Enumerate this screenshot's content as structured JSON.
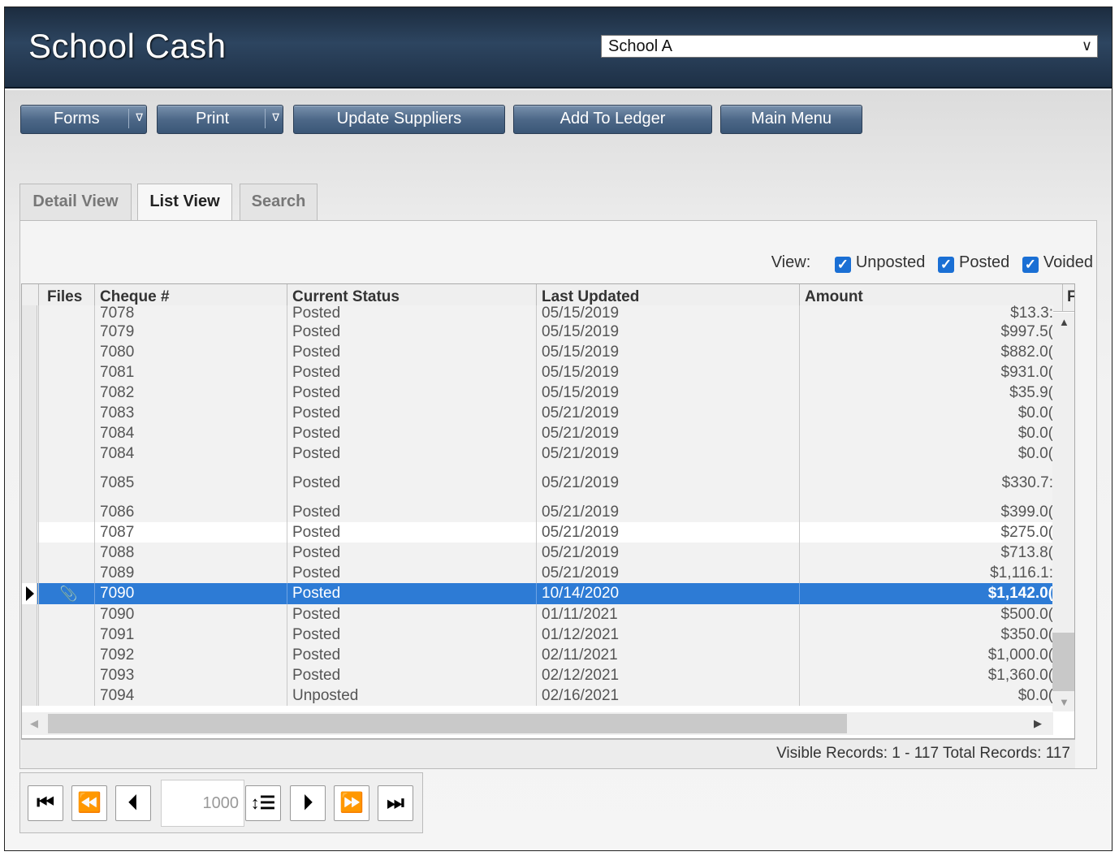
{
  "header": {
    "title": "School Cash",
    "school_select": "School A"
  },
  "toolbar": {
    "forms": "Forms",
    "print": "Print",
    "dropdown_glyph": "∇",
    "update_suppliers": "Update Suppliers",
    "add_to_ledger": "Add To Ledger",
    "main_menu": "Main Menu"
  },
  "tabs": {
    "detail": "Detail View",
    "list": "List View",
    "search": "Search",
    "active": "List View"
  },
  "view_filter": {
    "label": "View:",
    "unposted": "Unposted",
    "unposted_checked": true,
    "posted": "Posted",
    "posted_checked": true,
    "voided": "Voided",
    "voided_checked": true
  },
  "grid": {
    "columns": [
      "Files",
      "Cheque #",
      "Current Status",
      "Last Updated",
      "Amount",
      "F"
    ],
    "rows": [
      {
        "cheque": "7078",
        "status": "Posted",
        "updated": "05/15/2019",
        "amount": "$13.3:"
      },
      {
        "cheque": "7079",
        "status": "Posted",
        "updated": "05/15/2019",
        "amount": "$997.5("
      },
      {
        "cheque": "7080",
        "status": "Posted",
        "updated": "05/15/2019",
        "amount": "$882.0("
      },
      {
        "cheque": "7081",
        "status": "Posted",
        "updated": "05/15/2019",
        "amount": "$931.0("
      },
      {
        "cheque": "7082",
        "status": "Posted",
        "updated": "05/15/2019",
        "amount": "$35.9("
      },
      {
        "cheque": "7083",
        "status": "Posted",
        "updated": "05/21/2019",
        "amount": "$0.0("
      },
      {
        "cheque": "7084",
        "status": "Posted",
        "updated": "05/21/2019",
        "amount": "$0.0("
      },
      {
        "cheque": "7084",
        "status": "Posted",
        "updated": "05/21/2019",
        "amount": "$0.0("
      },
      {
        "cheque": "7085",
        "status": "Posted",
        "updated": "05/21/2019",
        "amount": "$330.7:"
      },
      {
        "cheque": "7086",
        "status": "Posted",
        "updated": "05/21/2019",
        "amount": "$399.0("
      },
      {
        "cheque": "7087",
        "status": "Posted",
        "updated": "05/21/2019",
        "amount": "$275.0("
      },
      {
        "cheque": "7088",
        "status": "Posted",
        "updated": "05/21/2019",
        "amount": "$713.8("
      },
      {
        "cheque": "7089",
        "status": "Posted",
        "updated": "05/21/2019",
        "amount": "$1,116.1:"
      },
      {
        "cheque": "7090",
        "status": "Posted",
        "updated": "10/14/2020",
        "amount": "$1,142.0(",
        "selected": true,
        "has_file": true
      },
      {
        "cheque": "7090",
        "status": "Posted",
        "updated": "01/11/2021",
        "amount": "$500.0("
      },
      {
        "cheque": "7091",
        "status": "Posted",
        "updated": "01/12/2021",
        "amount": "$350.0("
      },
      {
        "cheque": "7092",
        "status": "Posted",
        "updated": "02/11/2021",
        "amount": "$1,000.0("
      },
      {
        "cheque": "7093",
        "status": "Posted",
        "updated": "02/12/2021",
        "amount": "$1,360.0("
      },
      {
        "cheque": "7094",
        "status": "Unposted",
        "updated": "02/16/2021",
        "amount": "$0.0("
      }
    ]
  },
  "status_line": "Visible Records: 1 - 117 Total Records: 117",
  "pager": {
    "first_icon": "first-page-icon",
    "prev_group_icon": "rewind-icon",
    "prev_icon": "previous-icon",
    "page_size": "1000",
    "next_icon": "next-icon",
    "next_group_icon": "fast-forward-icon",
    "last_icon": "last-page-icon"
  }
}
